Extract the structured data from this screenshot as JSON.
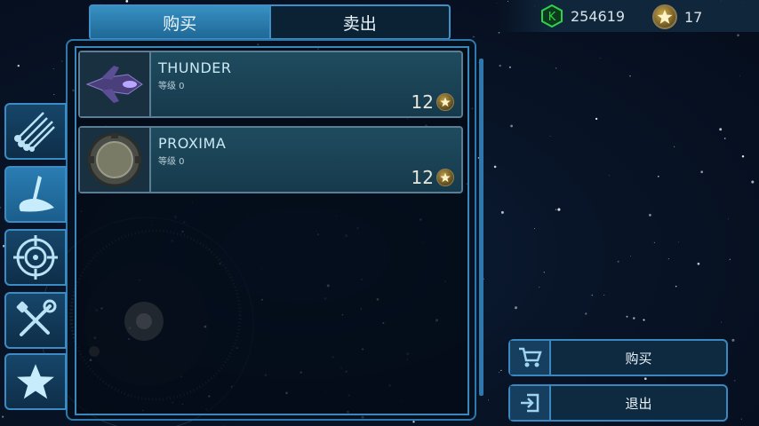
{
  "tabs": [
    {
      "label": "购买",
      "active": true
    },
    {
      "label": "卖出",
      "active": false
    }
  ],
  "resources": {
    "credits": "254619",
    "stars": "17",
    "credit_icon": "credit-hex-icon",
    "star_icon": "star-coin-icon"
  },
  "items": [
    {
      "name": "THUNDER",
      "level": "等级 0",
      "price": "12",
      "icon": "ship-thunder-icon"
    },
    {
      "name": "PROXIMA",
      "level": "等级 0",
      "price": "12",
      "icon": "module-proxima-icon"
    }
  ],
  "side_tabs": [
    {
      "icon": "missiles-icon",
      "active": false
    },
    {
      "icon": "hull-icon",
      "active": true
    },
    {
      "icon": "crosshair-icon",
      "active": false
    },
    {
      "icon": "tools-icon",
      "active": false
    },
    {
      "icon": "star-icon",
      "active": false
    }
  ],
  "actions": {
    "buy_label": "购买",
    "exit_label": "退出",
    "buy_icon": "cart-icon",
    "exit_icon": "exit-icon"
  },
  "colors": {
    "accent": "#3f8fc8",
    "active_tab": "#2a7db3",
    "credit_green": "#2fd24a",
    "card_bg": "#1f4b5f"
  }
}
